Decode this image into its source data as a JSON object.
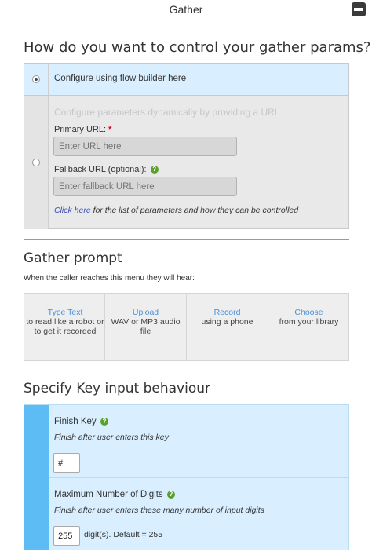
{
  "window": {
    "title": "Gather"
  },
  "control": {
    "heading": "How do you want to control your gather params?",
    "option_flow_builder": "Configure using flow builder here",
    "option_url_title": "Configure parameters dynamically by providing a URL",
    "primary_url_label": "Primary URL:",
    "required_mark": "*",
    "primary_url_placeholder": "Enter URL here",
    "fallback_url_label": "Fallback URL (optional):",
    "fallback_url_placeholder": "Enter fallback URL here",
    "click_here_link": "Click here",
    "click_here_note": " for the list of parameters and how they can be controlled"
  },
  "prompt": {
    "heading": "Gather prompt",
    "subtitle": "When the caller reaches this menu they will hear:",
    "choices": [
      {
        "title": "Type Text",
        "desc": "to read like a robot or to get it recorded"
      },
      {
        "title": "Upload",
        "desc": "WAV or MP3 audio file"
      },
      {
        "title": "Record",
        "desc": "using a phone"
      },
      {
        "title": "Choose",
        "desc": "from your library"
      }
    ]
  },
  "keys": {
    "heading": "Specify Key input behaviour",
    "finish_key_label": "Finish Key",
    "finish_key_desc": "Finish after user enters this key",
    "finish_key_value": "#",
    "max_digits_label": "Maximum Number of Digits",
    "max_digits_desc": "Finish after user enters these many number of input digits",
    "max_digits_value": "255",
    "max_digits_suffix": "digit(s). Default = 255"
  },
  "icons": {
    "help": "?",
    "collapse": "minus-icon"
  },
  "colors": {
    "accent_blue": "#5cbcf3",
    "selected_bg": "#d9efff",
    "link": "#4a90d6",
    "help_green": "#5aa02c"
  }
}
